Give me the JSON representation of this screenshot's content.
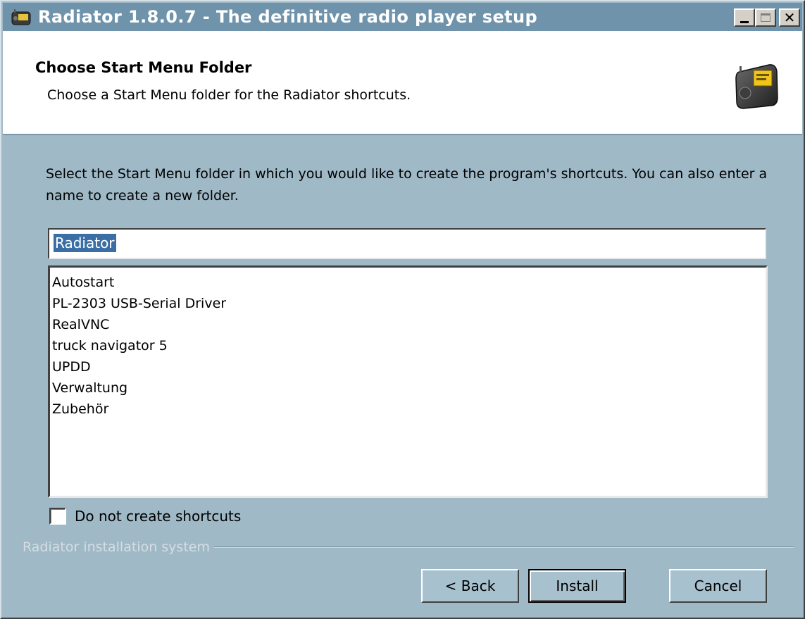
{
  "window": {
    "title": "Radiator 1.8.0.7 - The definitive radio player setup",
    "icon": "radio-icon"
  },
  "header": {
    "title": "Choose Start Menu Folder",
    "subtitle": "Choose a Start Menu folder for the Radiator shortcuts.",
    "icon": "radio-device-icon"
  },
  "body": {
    "instructions": "Select the Start Menu folder in which you would like to create the program's shortcuts. You can also enter a name to create a new folder.",
    "folder_input_value": "Radiator",
    "folders": [
      "Autostart",
      "PL-2303 USB-Serial Driver",
      "RealVNC",
      "truck navigator 5",
      "UPDD",
      "Verwaltung",
      "Zubehör"
    ],
    "checkbox_label": "Do not create shortcuts",
    "checkbox_checked": false
  },
  "footer": {
    "branding": "Radiator installation system",
    "back_label": "< Back",
    "install_label": "Install",
    "cancel_label": "Cancel"
  },
  "colors": {
    "titlebar": "#6f93ab",
    "body_bg": "#9fb9c7",
    "selection": "#3a6ea5"
  }
}
